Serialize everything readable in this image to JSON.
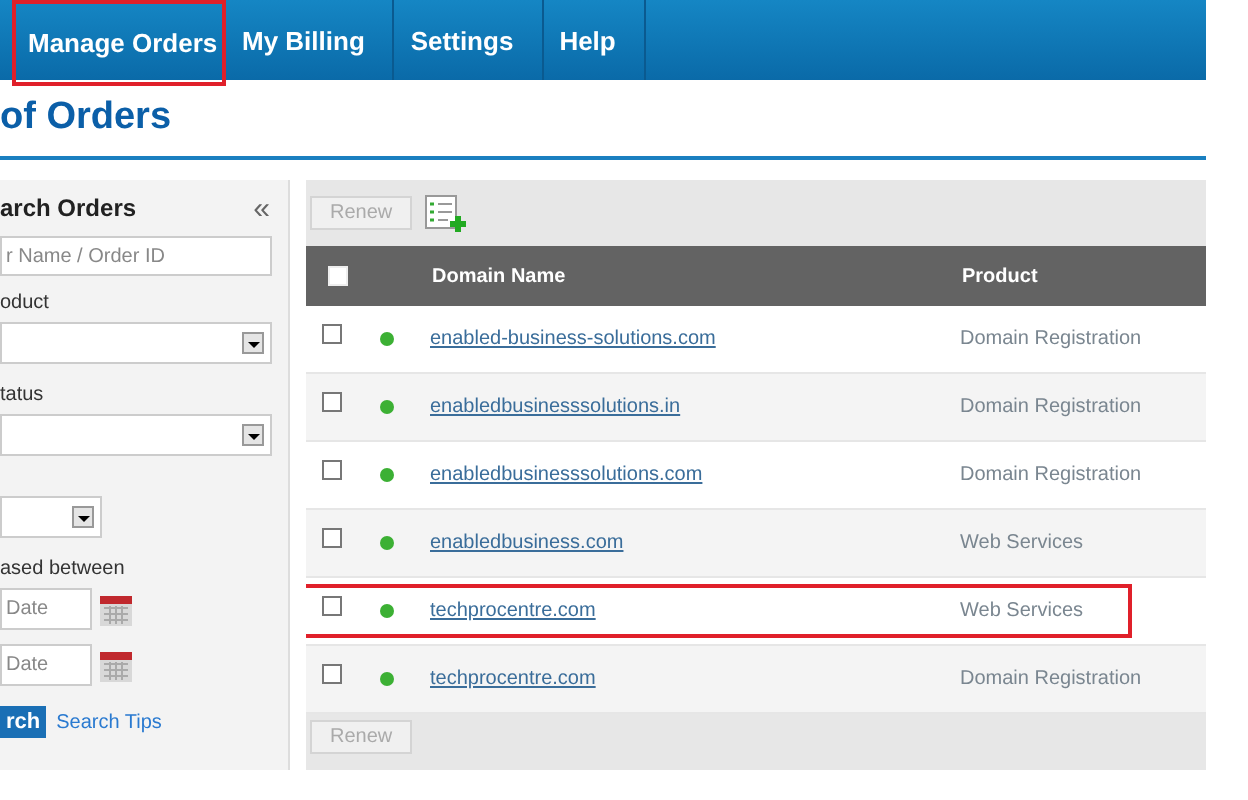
{
  "nav": [
    {
      "label": "Manage Orders",
      "highlighted": true
    },
    {
      "label": "My Billing",
      "highlighted": false
    },
    {
      "label": "Settings",
      "highlighted": false
    },
    {
      "label": "Help",
      "highlighted": false
    }
  ],
  "page_title": "of Orders",
  "sidebar": {
    "title": "arch Orders",
    "collapse": "«",
    "search_placeholder": "r Name / Order ID",
    "product_label": "oduct",
    "status_label": "tatus",
    "date_label": "ased between",
    "date_from_placeholder": "Date",
    "date_to_placeholder": "Date",
    "search_button": "rch",
    "tips_link": "Search Tips"
  },
  "toolbar": {
    "renew": "Renew"
  },
  "table": {
    "columns": [
      "Domain Name",
      "Product"
    ],
    "select_all_checked": false,
    "rows": [
      {
        "domain": "enabled-business-solutions.com",
        "product": "Domain Registration",
        "checked": false,
        "color": "#3cb034",
        "highlighted": false
      },
      {
        "domain": "enabledbusinesssolutions.in",
        "product": "Domain Registration",
        "checked": false,
        "color": "#3cb034",
        "highlighted": false
      },
      {
        "domain": "enabledbusinesssolutions.com",
        "product": "Domain Registration",
        "checked": false,
        "color": "#3cb034",
        "highlighted": false
      },
      {
        "domain": "enabledbusiness.com",
        "product": "Web Services",
        "checked": false,
        "color": "#3cb034",
        "highlighted": false
      },
      {
        "domain": "techprocentre.com",
        "product": "Web Services",
        "checked": false,
        "color": "#3cb034",
        "highlighted": true
      },
      {
        "domain": "techprocentre.com",
        "product": "Domain Registration",
        "checked": false,
        "color": "#3cb034",
        "highlighted": false
      }
    ]
  },
  "bottom_toolbar": {
    "renew": "Renew"
  }
}
